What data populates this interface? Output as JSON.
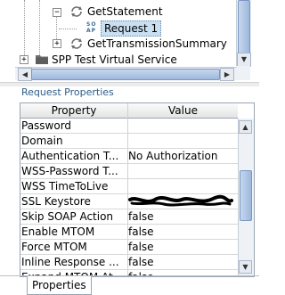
{
  "tree": {
    "nodes": [
      {
        "label": "GetStatement",
        "expander": "−",
        "icon": "refresh-cycle-icon"
      },
      {
        "label": "Request 1",
        "icon": "soap-request-icon",
        "icon_text": "SO\nAP",
        "selected": true
      },
      {
        "label": "GetTransmissionSummary",
        "expander": "+",
        "icon": "refresh-cycle-icon"
      },
      {
        "label": "SPP Test Virtual Service",
        "expander": "+",
        "icon": "folder-icon"
      }
    ],
    "scroll_down_glyph": "▼",
    "scroll_left_glyph": "◀",
    "scroll_right_glyph": "▶"
  },
  "request_properties": {
    "title": "Request Properties",
    "columns": [
      "Property",
      "Value"
    ],
    "rows": [
      {
        "property": "Password",
        "value": ""
      },
      {
        "property": "Domain",
        "value": ""
      },
      {
        "property": "Authentication T...",
        "value": "No Authorization"
      },
      {
        "property": "WSS-Password T...",
        "value": ""
      },
      {
        "property": "WSS TimeToLive",
        "value": ""
      },
      {
        "property": "SSL Keystore",
        "value": "redacted",
        "redacted": true
      },
      {
        "property": "Skip SOAP Action",
        "value": "false"
      },
      {
        "property": "Enable MTOM",
        "value": "false"
      },
      {
        "property": "Force MTOM",
        "value": "false"
      },
      {
        "property": "Inline Response ...",
        "value": "false"
      },
      {
        "property": "Expand MTOM At...",
        "value": "false"
      }
    ],
    "scroll_up_glyph": "▲",
    "scroll_down_glyph": "▼"
  },
  "tabs": {
    "properties_label": "Properties"
  },
  "colors": {
    "title": "#2d5c8a",
    "selection": "#c9dff2",
    "scroll_thumb": "#9db8dd"
  }
}
